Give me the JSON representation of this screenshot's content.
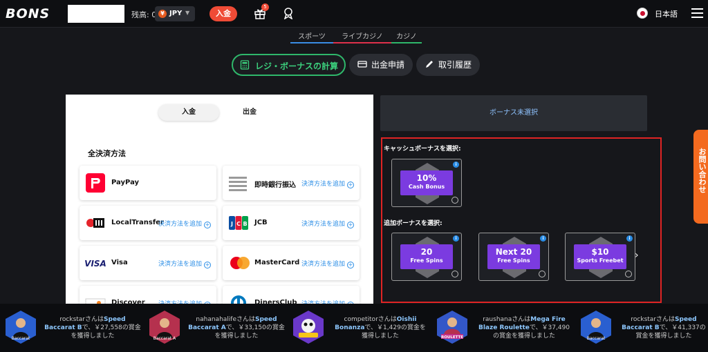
{
  "header": {
    "logo": "BONS",
    "balance_label": "残高: 0",
    "currency": "JPY",
    "currency_symbol": "¥",
    "deposit_label": "入金",
    "gift_badge_count": "5",
    "language": "日本語"
  },
  "nav_tabs": [
    {
      "label": "スポーツ",
      "color": "#3a8de6"
    },
    {
      "label": "ライブカジノ",
      "color": "#e0314b"
    },
    {
      "label": "カジノ",
      "color": "#2fb86b"
    }
  ],
  "actions": {
    "calc_label": "レジ・ボーナスの計算",
    "withdraw_label": "出金申請",
    "history_label": "取引履歴"
  },
  "panel": {
    "tab_deposit": "入金",
    "tab_withdraw": "出金",
    "section_title": "全決済方法",
    "methods": [
      {
        "name": "PayPay",
        "add": ""
      },
      {
        "name": "即時銀行振込",
        "add": "決済方法を追加"
      },
      {
        "name": "LocalTransfer",
        "add": "決済方法を追加"
      },
      {
        "name": "JCB",
        "add": "決済方法を追加"
      },
      {
        "name": "Visa",
        "add": "決済方法を追加"
      },
      {
        "name": "MasterCard",
        "add": "決済方法を追加"
      },
      {
        "name": "Discover",
        "add": "決済方法を追加"
      },
      {
        "name": "DinersClub",
        "add": "決済方法を追加"
      }
    ]
  },
  "bonus": {
    "none_label": "ボーナス未選択",
    "cash_title": "キャッシュボーナスを選択:",
    "cash_cards": [
      {
        "big": "10%",
        "small": "Cash Bonus"
      }
    ],
    "extra_title": "追加ボーナスを選択:",
    "extra_cards": [
      {
        "big": "20",
        "small": "Free Spins"
      },
      {
        "big": "Next 20",
        "small": "Free Spins"
      },
      {
        "big": "$10",
        "small": "Sports Freebet"
      }
    ]
  },
  "side_tab": "お問い合わせ",
  "ticker": [
    {
      "user": "rockstarさんは",
      "game": "Speed Baccarat B",
      "mid": "で、",
      "amount": "￥27,558",
      "tail": "の賞金を獲得しました",
      "color": "#2a5fd0",
      "thumb_label": "Baccarat"
    },
    {
      "user": "nahanahalifeさんは",
      "game": "Speed Baccarat A",
      "mid": "で、",
      "amount": "￥33,150",
      "tail": "の賞金を獲得しました",
      "color": "#b5314e",
      "thumb_label": "Baccarat A"
    },
    {
      "user": "competitorさんは",
      "game": "Oishii Bonanza",
      "mid": "で、",
      "amount": "￥1,429",
      "tail": "の賞金を獲得しました",
      "color": "#6a38c9",
      "thumb_label": ""
    },
    {
      "user": "raushanaさんは",
      "game": "Mega Fire Blaze Roulette",
      "mid": "で、",
      "amount": "￥37,490",
      "tail": "の賞金を獲得しました",
      "color": "#3357c8",
      "thumb_label": "ROULETTE"
    },
    {
      "user": "rockstarさんは",
      "game": "Speed Baccarat B",
      "mid": "で、",
      "amount": "￥41,337",
      "tail": "の賞金を獲得しました",
      "color": "#2a5fd0",
      "thumb_label": "Baccarat"
    }
  ]
}
